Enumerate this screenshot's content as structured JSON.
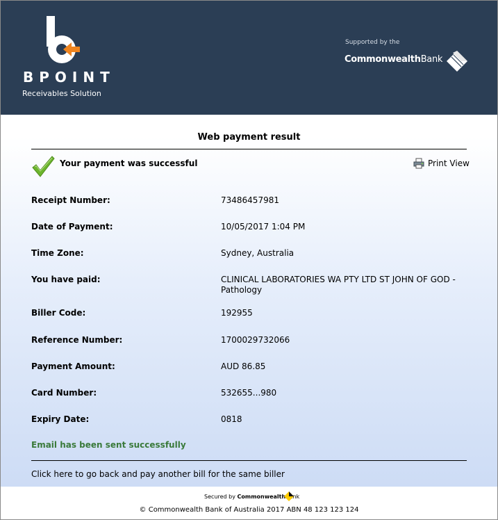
{
  "header": {
    "brand_name": "BPOINT",
    "brand_tagline": "Receivables Solution",
    "supported_by": "Supported by the",
    "bank_name_bold": "Commonwealth",
    "bank_name_regular": "Bank"
  },
  "result": {
    "title": "Web payment result",
    "success_message": "Your payment was successful",
    "print_view_label": "Print View",
    "fields": [
      {
        "label": "Receipt Number:",
        "value": "73486457981"
      },
      {
        "label": "Date of Payment:",
        "value": "10/05/2017 1:04 PM"
      },
      {
        "label": "Time Zone:",
        "value": "Sydney, Australia"
      },
      {
        "label": "You have paid:",
        "value": "CLINICAL LABORATORIES WA PTY LTD ST JOHN OF GOD - Pathology"
      },
      {
        "label": "Biller Code:",
        "value": "192955"
      },
      {
        "label": "Reference Number:",
        "value": "1700029732066"
      },
      {
        "label": "Payment Amount:",
        "value": "AUD 86.85"
      },
      {
        "label": "Card Number:",
        "value": "532655...980"
      },
      {
        "label": "Expiry Date:",
        "value": "0818"
      }
    ],
    "email_status": "Email has been sent successfully",
    "back_link": "Click here to go back and pay another bill for the same biller"
  },
  "footer": {
    "secured_by": "Secured by",
    "secured_bank_bold": "Commonwealth",
    "secured_bank_regular": "Bank",
    "copyright": "© Commonwealth Bank of Australia 2017 ABN 48 123 123 124"
  },
  "colors": {
    "header_bg": "#2b3e55",
    "accent_orange": "#f0851f",
    "success_green": "#3a7a3a",
    "check_green": "#6cb52d",
    "cba_yellow": "#ffcc00"
  },
  "icons": {
    "logo": "bpoint-logo-icon",
    "bank": "commonwealth-diamond-icon",
    "success": "checkmark-icon",
    "print": "printer-icon"
  }
}
